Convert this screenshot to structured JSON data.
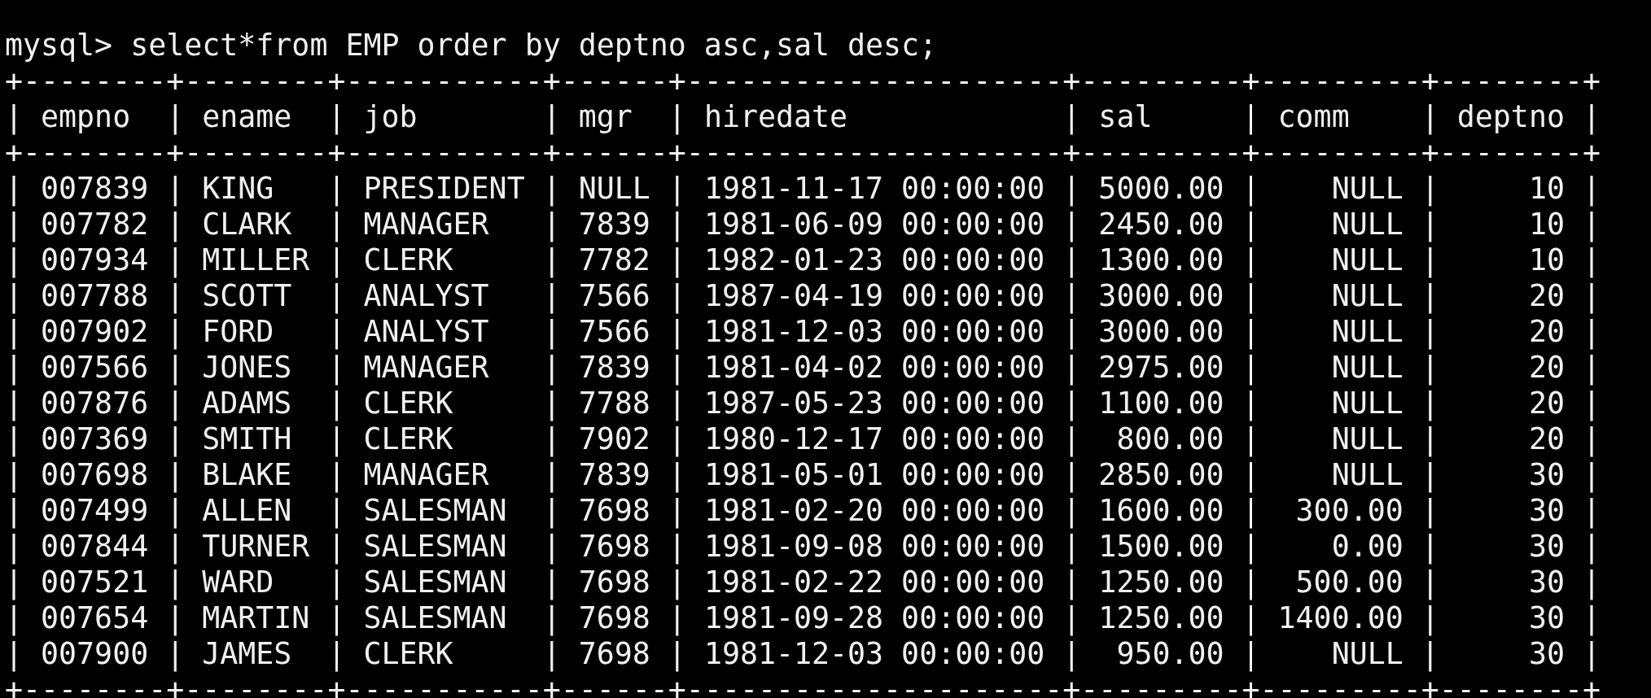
{
  "prompt": "mysql>",
  "command": "select*from EMP order by deptno asc,sal desc;",
  "separator": "|",
  "borders": {
    "top": "+--------+--------+-----------+------+---------------------+---------+---------+--------+",
    "header_bottom": "+--------+--------+-----------+------+---------------------+---------+---------+--------+",
    "bottom": "+--------+--------+-----------+------+---------------------+---------+---------+--------+"
  },
  "table": {
    "columns": [
      {
        "name": "empno"
      },
      {
        "name": "ename"
      },
      {
        "name": "job"
      },
      {
        "name": "mgr"
      },
      {
        "name": "hiredate"
      },
      {
        "name": "sal",
        "numeric": true
      },
      {
        "name": "comm",
        "numeric": true
      },
      {
        "name": "deptno",
        "numeric": true
      }
    ],
    "rows": [
      [
        "007839",
        "KING",
        "PRESIDENT",
        "NULL",
        "1981-11-17 00:00:00",
        "5000.00",
        "NULL",
        "10"
      ],
      [
        "007782",
        "CLARK",
        "MANAGER",
        "7839",
        "1981-06-09 00:00:00",
        "2450.00",
        "NULL",
        "10"
      ],
      [
        "007934",
        "MILLER",
        "CLERK",
        "7782",
        "1982-01-23 00:00:00",
        "1300.00",
        "NULL",
        "10"
      ],
      [
        "007788",
        "SCOTT",
        "ANALYST",
        "7566",
        "1987-04-19 00:00:00",
        "3000.00",
        "NULL",
        "20"
      ],
      [
        "007902",
        "FORD",
        "ANALYST",
        "7566",
        "1981-12-03 00:00:00",
        "3000.00",
        "NULL",
        "20"
      ],
      [
        "007566",
        "JONES",
        "MANAGER",
        "7839",
        "1981-04-02 00:00:00",
        "2975.00",
        "NULL",
        "20"
      ],
      [
        "007876",
        "ADAMS",
        "CLERK",
        "7788",
        "1987-05-23 00:00:00",
        "1100.00",
        "NULL",
        "20"
      ],
      [
        "007369",
        "SMITH",
        "CLERK",
        "7902",
        "1980-12-17 00:00:00",
        "800.00",
        "NULL",
        "20"
      ],
      [
        "007698",
        "BLAKE",
        "MANAGER",
        "7839",
        "1981-05-01 00:00:00",
        "2850.00",
        "NULL",
        "30"
      ],
      [
        "007499",
        "ALLEN",
        "SALESMAN",
        "7698",
        "1981-02-20 00:00:00",
        "1600.00",
        "300.00",
        "30"
      ],
      [
        "007844",
        "TURNER",
        "SALESMAN",
        "7698",
        "1981-09-08 00:00:00",
        "1500.00",
        "0.00",
        "30"
      ],
      [
        "007521",
        "WARD",
        "SALESMAN",
        "7698",
        "1981-02-22 00:00:00",
        "1250.00",
        "500.00",
        "30"
      ],
      [
        "007654",
        "MARTIN",
        "SALESMAN",
        "7698",
        "1981-09-28 00:00:00",
        "1250.00",
        "1400.00",
        "30"
      ],
      [
        "007900",
        "JAMES",
        "CLERK",
        "7698",
        "1981-12-03 00:00:00",
        "950.00",
        "NULL",
        "30"
      ]
    ]
  }
}
